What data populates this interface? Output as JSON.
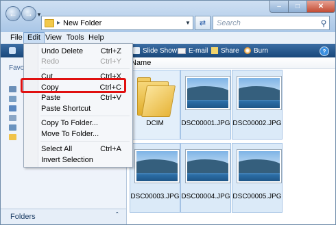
{
  "address": {
    "path": "New Folder"
  },
  "search": {
    "placeholder": "Search"
  },
  "menubar": [
    "File",
    "Edit",
    "View",
    "Tools",
    "Help"
  ],
  "toolbar": {
    "slideshow": "Slide Show",
    "email": "E-mail",
    "share": "Share",
    "burn": "Burn"
  },
  "navpane": {
    "favorites_partial": "Favo",
    "folders": "Folders"
  },
  "content": {
    "column_name": "Name"
  },
  "files": [
    {
      "name": "DCIM",
      "type": "folder"
    },
    {
      "name": "DSC00001.JPG",
      "type": "image"
    },
    {
      "name": "DSC00002.JPG",
      "type": "image"
    },
    {
      "name": "DSC00003.JPG",
      "type": "image"
    },
    {
      "name": "DSC00004.JPG",
      "type": "image"
    },
    {
      "name": "DSC00005.JPG",
      "type": "image"
    }
  ],
  "edit_menu": [
    {
      "label": "Undo Delete",
      "shortcut": "Ctrl+Z",
      "disabled": false
    },
    {
      "label": "Redo",
      "shortcut": "Ctrl+Y",
      "disabled": true
    },
    {
      "label": "Cut",
      "shortcut": "Ctrl+X",
      "disabled": false
    },
    {
      "label": "Copy",
      "shortcut": "Ctrl+C",
      "disabled": false
    },
    {
      "label": "Paste",
      "shortcut": "Ctrl+V",
      "disabled": false
    },
    {
      "label": "Paste Shortcut",
      "shortcut": "",
      "disabled": false
    },
    {
      "label": "Copy To Folder...",
      "shortcut": "",
      "disabled": false
    },
    {
      "label": "Move To Folder...",
      "shortcut": "",
      "disabled": false
    },
    {
      "label": "Select All",
      "shortcut": "Ctrl+A",
      "disabled": false
    },
    {
      "label": "Invert Selection",
      "shortcut": "",
      "disabled": false
    }
  ],
  "colors": {
    "highlight": "#e01010",
    "toolbar": "#1f4d82"
  }
}
